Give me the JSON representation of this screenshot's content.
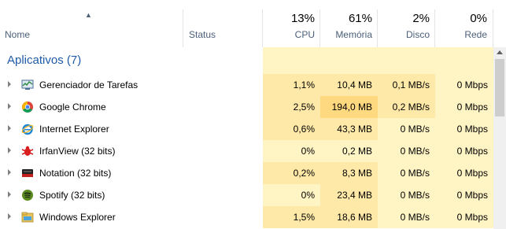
{
  "header": {
    "columns": {
      "name": {
        "label": "Nome"
      },
      "status": {
        "label": "Status"
      },
      "cpu": {
        "label": "CPU",
        "total": "13%"
      },
      "memory": {
        "label": "Memória",
        "total": "61%"
      },
      "disk": {
        "label": "Disco",
        "total": "2%"
      },
      "network": {
        "label": "Rede",
        "total": "0%"
      }
    },
    "sort_arrow": "^"
  },
  "group": {
    "title": "Aplicativos (7)"
  },
  "processes": [
    {
      "name": "Gerenciador de Tarefas",
      "icon": "task-manager-icon",
      "cpu": "1,1%",
      "memory": "10,4 MB",
      "disk": "0,1 MB/s",
      "network": "0 Mbps"
    },
    {
      "name": "Google Chrome",
      "icon": "chrome-icon",
      "cpu": "2,5%",
      "memory": "194,0 MB",
      "disk": "0,2 MB/s",
      "network": "0 Mbps"
    },
    {
      "name": "Internet Explorer",
      "icon": "internet-explorer-icon",
      "cpu": "0,6%",
      "memory": "43,3 MB",
      "disk": "0 MB/s",
      "network": "0 Mbps"
    },
    {
      "name": "IrfanView (32 bits)",
      "icon": "irfanview-icon",
      "cpu": "0%",
      "memory": "0,2 MB",
      "disk": "0 MB/s",
      "network": "0 Mbps"
    },
    {
      "name": "Notation (32 bits)",
      "icon": "notation-icon",
      "cpu": "0,2%",
      "memory": "8,3 MB",
      "disk": "0 MB/s",
      "network": "0 Mbps"
    },
    {
      "name": "Spotify (32 bits)",
      "icon": "spotify-icon",
      "cpu": "0%",
      "memory": "23,4 MB",
      "disk": "0 MB/s",
      "network": "0 Mbps"
    },
    {
      "name": "Windows Explorer",
      "icon": "windows-explorer-icon",
      "cpu": "1,5%",
      "memory": "18,6 MB",
      "disk": "0 MB/s",
      "network": "0 Mbps"
    }
  ]
}
